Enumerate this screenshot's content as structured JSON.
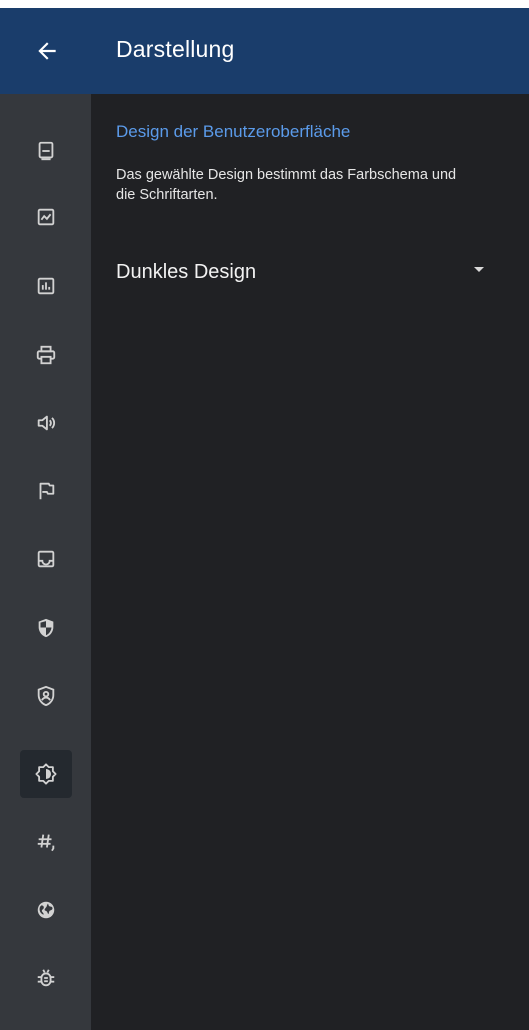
{
  "appbar": {
    "title": "Darstellung",
    "back_icon": "arrow-back-icon"
  },
  "rail": {
    "items": [
      {
        "name": "display-icon"
      },
      {
        "name": "image-icon"
      },
      {
        "name": "chart-icon"
      },
      {
        "name": "printer-icon"
      },
      {
        "name": "speaker-icon"
      },
      {
        "name": "flag-icon"
      },
      {
        "name": "inbox-icon"
      },
      {
        "name": "shield-icon"
      },
      {
        "name": "user-shield-icon"
      },
      {
        "name": "brightness-icon",
        "active": true
      },
      {
        "name": "hash-icon"
      },
      {
        "name": "globe-icon"
      },
      {
        "name": "bug-icon"
      }
    ]
  },
  "main": {
    "section_title": "Design der Benutzeroberfläche",
    "section_description": "Das gewählte Design bestimmt das Farbschema und die Schriftarten.",
    "design_select": {
      "value": "Dunkles Design"
    }
  },
  "colors": {
    "appbar": "#1a3d6b",
    "rail": "#35383d",
    "content": "#202124",
    "accent": "#5b9bea",
    "icon": "#d2d2d2"
  }
}
